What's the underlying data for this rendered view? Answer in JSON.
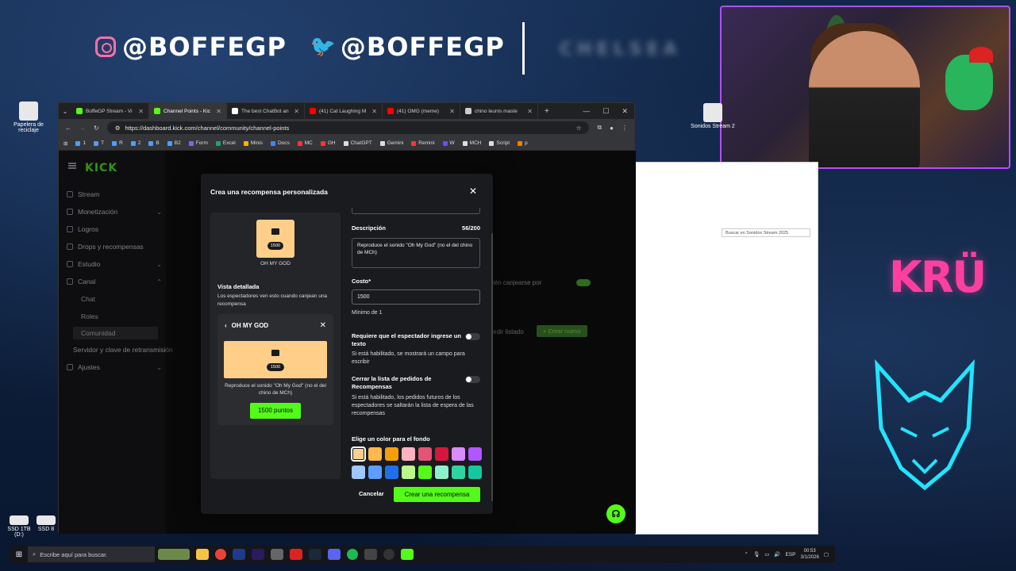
{
  "overlay": {
    "instagram_handle": "@BOFFEGP",
    "twitter_handle": "@BOFFEGP",
    "blurred_text": "CHELSEA",
    "brand_logo": "KRÜ"
  },
  "desktop": {
    "icons": [
      {
        "label": "Papelera de reciclaje"
      },
      {
        "label": "Sonidos Stream 2"
      },
      {
        "label": "SSD 1TB (D:)"
      },
      {
        "label": "SSD 8"
      }
    ]
  },
  "browser": {
    "tabs": [
      {
        "label": "BoffeGP Stream - Vi",
        "color": "#53fc18"
      },
      {
        "label": "Channel Points - Kic",
        "color": "#53fc18",
        "active": true
      },
      {
        "label": "The best ChatBot an",
        "color": "#ffffff"
      },
      {
        "label": "(41) Cat Laughing M",
        "color": "#ff0000"
      },
      {
        "label": "(41) OMG (meme)",
        "color": "#ff0000"
      },
      {
        "label": "chino leunis maste",
        "color": "#cccccc"
      }
    ],
    "new_tab": "+",
    "url": "https://dashboard.kick.com/channel/community/channel-points",
    "bookmarks": [
      {
        "label": "1",
        "color": "#4a9eff"
      },
      {
        "label": "T",
        "color": "#4a9eff"
      },
      {
        "label": "R",
        "color": "#4a9eff"
      },
      {
        "label": "2",
        "color": "#4a9eff"
      },
      {
        "label": "B",
        "color": "#4a9eff"
      },
      {
        "label": "B2",
        "color": "#4a9eff"
      },
      {
        "label": "Form",
        "color": "#8b5cf6"
      },
      {
        "label": "Excel",
        "color": "#21a366"
      },
      {
        "label": "Minis",
        "color": "#f4b400"
      },
      {
        "label": "Docs",
        "color": "#4285f4"
      },
      {
        "label": "MC",
        "color": "#ff3333"
      },
      {
        "label": "GH",
        "color": "#ff3333"
      },
      {
        "label": "ChatGPT",
        "color": "#dddddd"
      },
      {
        "label": "Gemini",
        "color": "#dddddd"
      },
      {
        "label": "Remini",
        "color": "#ff3333"
      },
      {
        "label": "W",
        "color": "#6a4cff"
      },
      {
        "label": "MCH",
        "color": "#dddddd"
      },
      {
        "label": "Script",
        "color": "#dddddd"
      },
      {
        "label": "p",
        "color": "#ff7a00"
      }
    ]
  },
  "kick": {
    "logo": "KICK",
    "sidebar": [
      {
        "label": "Stream"
      },
      {
        "label": "Monetización",
        "chevron": "⌄"
      },
      {
        "label": "Logros"
      },
      {
        "label": "Drops y recompensas"
      },
      {
        "label": "Estudio",
        "chevron": "⌄"
      },
      {
        "label": "Canal",
        "chevron": "⌃"
      }
    ],
    "sidebar_sub": [
      "Chat",
      "Roles",
      "Comunidad"
    ],
    "sidebar_more": [
      "Servidor y clave de retransmisión",
      "Ajustes"
    ],
    "bg_labels": {
      "redeem": "ién canjearse por",
      "list": "edir listado",
      "create_new": "+ Crear nuevo"
    }
  },
  "modal": {
    "title": "Crea una recompensa personalizada",
    "preview": {
      "cost_badge": "1500",
      "name": "OH MY GOD",
      "detail_title": "Vista detallada",
      "detail_sub": "Los espectadores ven esto cuando canjean una recompensa",
      "card_title": "OH MY GOD",
      "card_cost": "1500",
      "card_description": "Reproduce el sonido \"Oh My God\" (no el del chino de MCh)",
      "card_points": "1500 puntos"
    },
    "form": {
      "description_label": "Descripción",
      "description_count": "56/200",
      "description_value": "Reproduce el sonido \"Oh My God\" (no el del chino de MCh)",
      "cost_label": "Costo*",
      "cost_value": "1500",
      "cost_min": "Mínimo de 1",
      "require_text_label": "Requiere que el espectador ingrese un texto",
      "require_text_help": "Si está habilitado, se mostrará un campo para escribir",
      "require_text_enabled": false,
      "skip_queue_label": "Cerrar la lista de pedidos de Recompensas",
      "skip_queue_help": "Si está habilitado, los pedidos futuros de los espectadores se saltarán la lista de espera de las recompensas",
      "skip_queue_enabled": false,
      "color_label": "Elige un color para el fondo",
      "colors": [
        "#ffcf8a",
        "#ffb84d",
        "#f59e0b",
        "#ffb3c1",
        "#e25575",
        "#d6173d",
        "#d88cff",
        "#b157ff",
        "#9ec8ff",
        "#5c9dff",
        "#1f6feb",
        "#bdf78b",
        "#53fc18",
        "#8ef0c8",
        "#2fd3a1",
        "#14c7a0"
      ],
      "selected_color": 0,
      "cancel_label": "Cancelar",
      "create_label": "Crear una recompensa"
    }
  },
  "explorer": {
    "search_placeholder": "Buscar en Sonidos Stream 2025"
  },
  "taskbar": {
    "search_placeholder": "Escribe aquí para buscar.",
    "lang": "ESP",
    "time": "00:53",
    "date": "3/1/2026"
  }
}
